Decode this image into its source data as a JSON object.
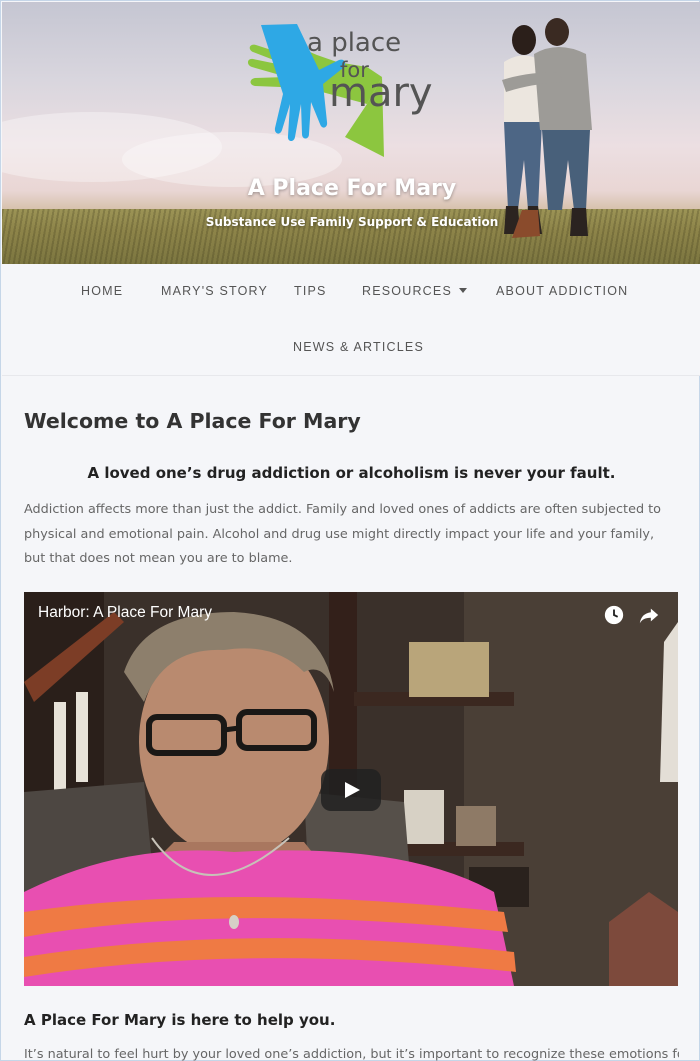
{
  "header": {
    "logo": {
      "line1": "a place",
      "line2": "for",
      "line3": "mary"
    },
    "site_title": "A Place For Mary",
    "tagline": "Substance Use Family Support & Education"
  },
  "nav": {
    "items": [
      {
        "label": "HOME"
      },
      {
        "label": "MARY'S STORY"
      },
      {
        "label": "TIPS"
      },
      {
        "label": "RESOURCES",
        "has_dropdown": true
      },
      {
        "label": "ABOUT ADDICTION"
      },
      {
        "label": "NEWS & ARTICLES"
      }
    ]
  },
  "main": {
    "title": "Welcome to A Place For Mary",
    "subheading": "A loved one’s drug addiction or alcoholism is never your fault.",
    "paragraph": "Addiction affects more than just the addict. Family and loved ones of addicts are often subjected to physical and emotional pain. Alcohol and drug use might directly impact your life and your family, but that does not mean you are to blame.",
    "video": {
      "title": "Harbor: A Place For Mary",
      "icons": [
        "watch-later-icon",
        "share-icon",
        "play-icon"
      ]
    },
    "help_heading": "A Place For Mary is here to help you.",
    "help_text": "It’s natural to feel hurt by your loved one’s addiction, but it’s important to recognize these emotions for"
  },
  "colors": {
    "logo_blue": "#2ea8e5",
    "logo_green": "#8cc63f",
    "logo_text": "#545454",
    "page_bg": "#f5f6f9",
    "nav_text": "#555555"
  }
}
